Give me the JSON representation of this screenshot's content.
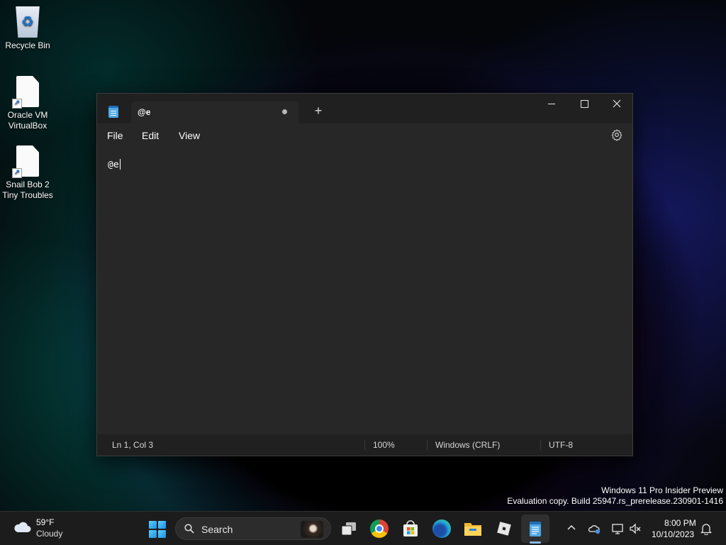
{
  "desktop": {
    "icons": [
      {
        "label": "Recycle Bin"
      },
      {
        "label": "Oracle VM VirtualBox"
      },
      {
        "label": "Snail Bob 2 Tiny Troubles"
      }
    ]
  },
  "notepad": {
    "tab_title": "@e",
    "menu": {
      "file": "File",
      "edit": "Edit",
      "view": "View"
    },
    "content": "@e",
    "status": {
      "position": "Ln 1, Col 3",
      "zoom": "100%",
      "line_ending": "Windows (CRLF)",
      "encoding": "UTF-8"
    },
    "icons": [
      "notepad-icon",
      "plus-icon",
      "minimize-icon",
      "maximize-icon",
      "close-icon",
      "gear-icon"
    ]
  },
  "watermark": {
    "line1": "Windows 11 Pro Insider Preview",
    "line2": "Evaluation copy. Build 25947.rs_prerelease.230901-1416"
  },
  "taskbar": {
    "weather": {
      "temp": "59°F",
      "condition": "Cloudy"
    },
    "search_label": "Search",
    "clock": {
      "time": "8:00 PM",
      "date": "10/10/2023"
    },
    "colors": {
      "background": "#1c1c1c",
      "accent": "#1a8fe3"
    }
  }
}
